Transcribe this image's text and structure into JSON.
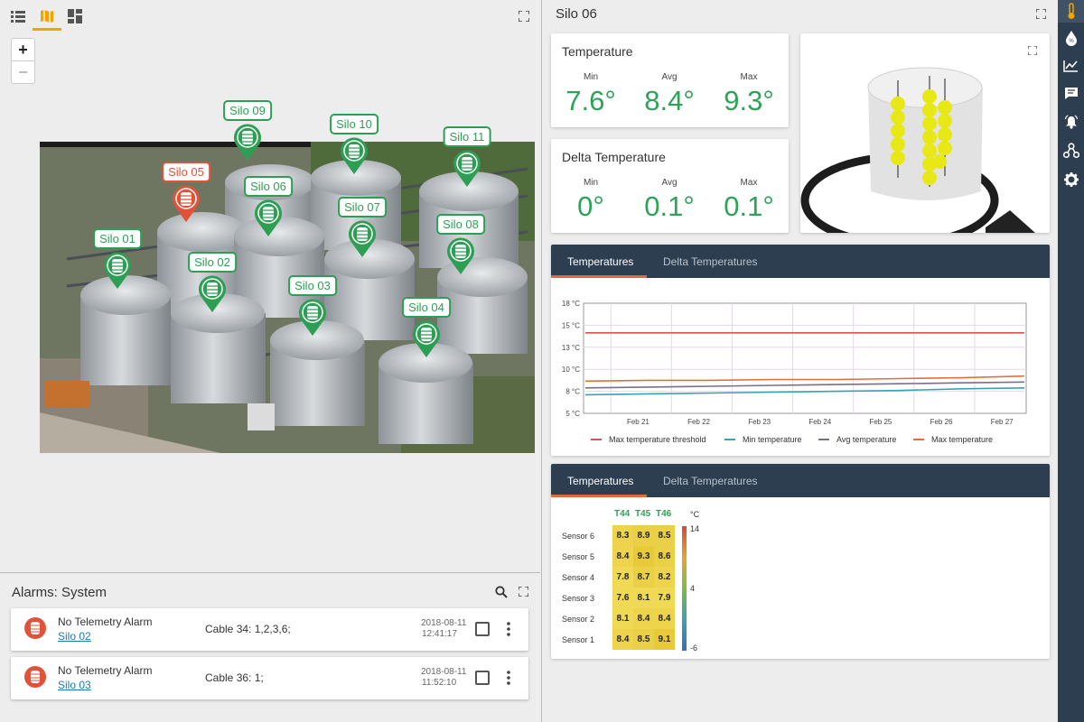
{
  "map": {
    "zoom_in": "+",
    "zoom_out": "−",
    "pins": [
      {
        "label": "Silo 01",
        "status": "ok"
      },
      {
        "label": "Silo 02",
        "status": "ok"
      },
      {
        "label": "Silo 03",
        "status": "ok"
      },
      {
        "label": "Silo 04",
        "status": "ok"
      },
      {
        "label": "Silo 05",
        "status": "alarm"
      },
      {
        "label": "Silo 06",
        "status": "ok"
      },
      {
        "label": "Silo 07",
        "status": "ok"
      },
      {
        "label": "Silo 08",
        "status": "ok"
      },
      {
        "label": "Silo 09",
        "status": "ok"
      },
      {
        "label": "Silo 10",
        "status": "ok"
      },
      {
        "label": "Silo 11",
        "status": "ok"
      }
    ]
  },
  "alarms": {
    "title": "Alarms: System",
    "items": [
      {
        "type": "No Telemetry Alarm",
        "source": "Silo 02",
        "message": "Cable 34: 1,2,3,6;",
        "date": "2018-08-11",
        "time": "12:41:17"
      },
      {
        "type": "No Telemetry Alarm",
        "source": "Silo 03",
        "message": "Cable 36: 1;",
        "date": "2018-08-11",
        "time": "11:52:10"
      }
    ]
  },
  "silo": {
    "title": "Silo 06",
    "temperature": {
      "title": "Temperature",
      "min_label": "Min",
      "avg_label": "Avg",
      "max_label": "Max",
      "min": "7.6°",
      "avg": "8.4°",
      "max": "9.3°"
    },
    "delta": {
      "title": "Delta Temperature",
      "min_label": "Min",
      "avg_label": "Avg",
      "max_label": "Max",
      "min": "0°",
      "avg": "0.1°",
      "max": "0.1°"
    }
  },
  "line_tabs": {
    "tab1": "Temperatures",
    "tab2": "Delta Temperatures"
  },
  "heat_tabs": {
    "tab1": "Temperatures",
    "tab2": "Delta Temperatures"
  },
  "colors": {
    "accent": "#f0a500",
    "ok": "#2e9e54",
    "alarm": "#e0523a",
    "nav": "#2d3e50"
  },
  "chart_data": [
    {
      "type": "line",
      "x": [
        "Feb 21",
        "Feb 22",
        "Feb 23",
        "Feb 24",
        "Feb 25",
        "Feb 26",
        "Feb 27"
      ],
      "y_ticks": [
        "18 °C",
        "15 °C",
        "13 °C",
        "10 °C",
        "8 °C",
        "5 °C"
      ],
      "ylim": [
        5,
        18
      ],
      "series": [
        {
          "name": "Max temperature threshold",
          "color": "#d9534f",
          "values": [
            14.5,
            14.5,
            14.5,
            14.5,
            14.5,
            14.5,
            14.5,
            14.5
          ]
        },
        {
          "name": "Min temperature",
          "color": "#3aa0b8",
          "values": [
            7.2,
            7.3,
            7.4,
            7.5,
            7.6,
            7.7,
            7.9,
            8.0
          ]
        },
        {
          "name": "Avg temperature",
          "color": "#7b6e8a",
          "values": [
            8.0,
            8.1,
            8.2,
            8.3,
            8.4,
            8.5,
            8.6,
            8.7
          ]
        },
        {
          "name": "Max temperature",
          "color": "#e0703b",
          "values": [
            8.8,
            8.9,
            8.9,
            9.0,
            9.0,
            9.1,
            9.2,
            9.4
          ]
        }
      ]
    },
    {
      "type": "heatmap",
      "columns": [
        "T44",
        "T45",
        "T46"
      ],
      "rows": [
        "Sensor 6",
        "Sensor 5",
        "Sensor 4",
        "Sensor 3",
        "Sensor 2",
        "Sensor 1"
      ],
      "values": [
        [
          8.3,
          8.9,
          8.5
        ],
        [
          8.4,
          9.3,
          8.6
        ],
        [
          7.8,
          8.7,
          8.2
        ],
        [
          7.6,
          8.1,
          7.9
        ],
        [
          8.1,
          8.4,
          8.4
        ],
        [
          8.4,
          8.5,
          9.1
        ]
      ],
      "scale_unit": "°C",
      "scale_labels": [
        "14",
        "4",
        "-6"
      ]
    }
  ]
}
